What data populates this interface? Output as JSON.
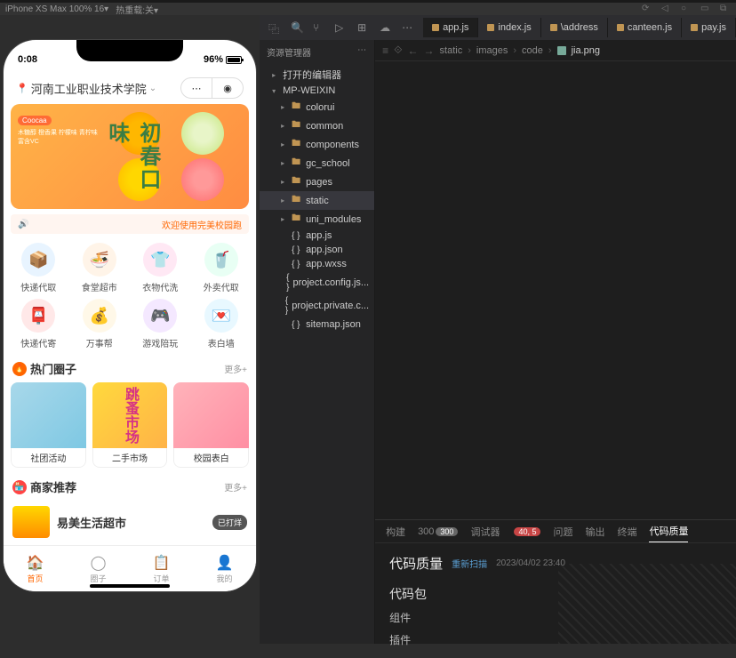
{
  "toolbar": {
    "device": "iPhone XS Max 100% 16▾",
    "hot": "热重载:关▾"
  },
  "phone": {
    "time": "0:08",
    "battery": "96%",
    "location": "河南工业职业技术学院",
    "banner": {
      "tag": "初春口味",
      "lines": "木糖醇\n橙香果\n柠檬味\n青柠味\n富含VC"
    },
    "notice": "欢迎使用完美校园跑",
    "grid": [
      {
        "icon": "📦",
        "label": "快递代取"
      },
      {
        "icon": "🍜",
        "label": "食堂超市"
      },
      {
        "icon": "👕",
        "label": "衣物代洗"
      },
      {
        "icon": "🥤",
        "label": "外卖代取"
      },
      {
        "icon": "📮",
        "label": "快递代寄"
      },
      {
        "icon": "💰",
        "label": "万事帮"
      },
      {
        "icon": "🎮",
        "label": "游戏陪玩"
      },
      {
        "icon": "💌",
        "label": "表白墙"
      }
    ],
    "sections": {
      "hot": {
        "title": "热门圈子",
        "more": "更多+",
        "cards": [
          {
            "label": "社团活动"
          },
          {
            "label": "二手市场",
            "mid": "跳蚤市场"
          },
          {
            "label": "校园表白"
          }
        ]
      },
      "shop": {
        "title": "商家推荐",
        "more": "更多+",
        "name": "易美生活超市",
        "badge": "已打烊"
      }
    },
    "tabs": [
      {
        "icon": "🏠",
        "label": "首页"
      },
      {
        "icon": "◯",
        "label": "圈子"
      },
      {
        "icon": "📋",
        "label": "订单"
      },
      {
        "icon": "👤",
        "label": "我的"
      }
    ]
  },
  "ide": {
    "tabs": [
      {
        "name": "app.js"
      },
      {
        "name": "index.js"
      },
      {
        "name": "\\address"
      },
      {
        "name": "canteen.js"
      },
      {
        "name": "pay.js"
      }
    ],
    "explorer": {
      "title": "资源管理器",
      "groups": [
        "打开的编辑器",
        "MP-WEIXIN"
      ],
      "tree": [
        {
          "t": "folder",
          "n": "colorui",
          "d": 1
        },
        {
          "t": "folder",
          "n": "common",
          "d": 1
        },
        {
          "t": "folder",
          "n": "components",
          "d": 1
        },
        {
          "t": "folder",
          "n": "gc_school",
          "d": 1
        },
        {
          "t": "folder",
          "n": "pages",
          "d": 1
        },
        {
          "t": "folder",
          "n": "static",
          "d": 1,
          "sel": true
        },
        {
          "t": "folder",
          "n": "uni_modules",
          "d": 1
        },
        {
          "t": "js",
          "n": "app.js",
          "d": 1
        },
        {
          "t": "json",
          "n": "app.json",
          "d": 1
        },
        {
          "t": "json",
          "n": "app.wxss",
          "d": 1
        },
        {
          "t": "json",
          "n": "project.config.js...",
          "d": 1
        },
        {
          "t": "json",
          "n": "project.private.c...",
          "d": 1
        },
        {
          "t": "json",
          "n": "sitemap.json",
          "d": 1
        }
      ]
    },
    "breadcrumb": [
      "static",
      "images",
      "code",
      "jia.png"
    ],
    "bottom": {
      "tabs": [
        {
          "n": "构建"
        },
        {
          "n": "300",
          "b": "300"
        },
        {
          "n": "调试器"
        },
        {
          "n": "",
          "b": "40, 5",
          "red": true
        },
        {
          "n": "问题"
        },
        {
          "n": "输出"
        },
        {
          "n": "终端"
        },
        {
          "n": "代码质量",
          "active": true
        }
      ],
      "title": "代码质量",
      "rescan": "重新扫描",
      "time": "2023/04/02 23:40",
      "rows": [
        "代码包",
        "组件",
        "插件"
      ]
    }
  }
}
